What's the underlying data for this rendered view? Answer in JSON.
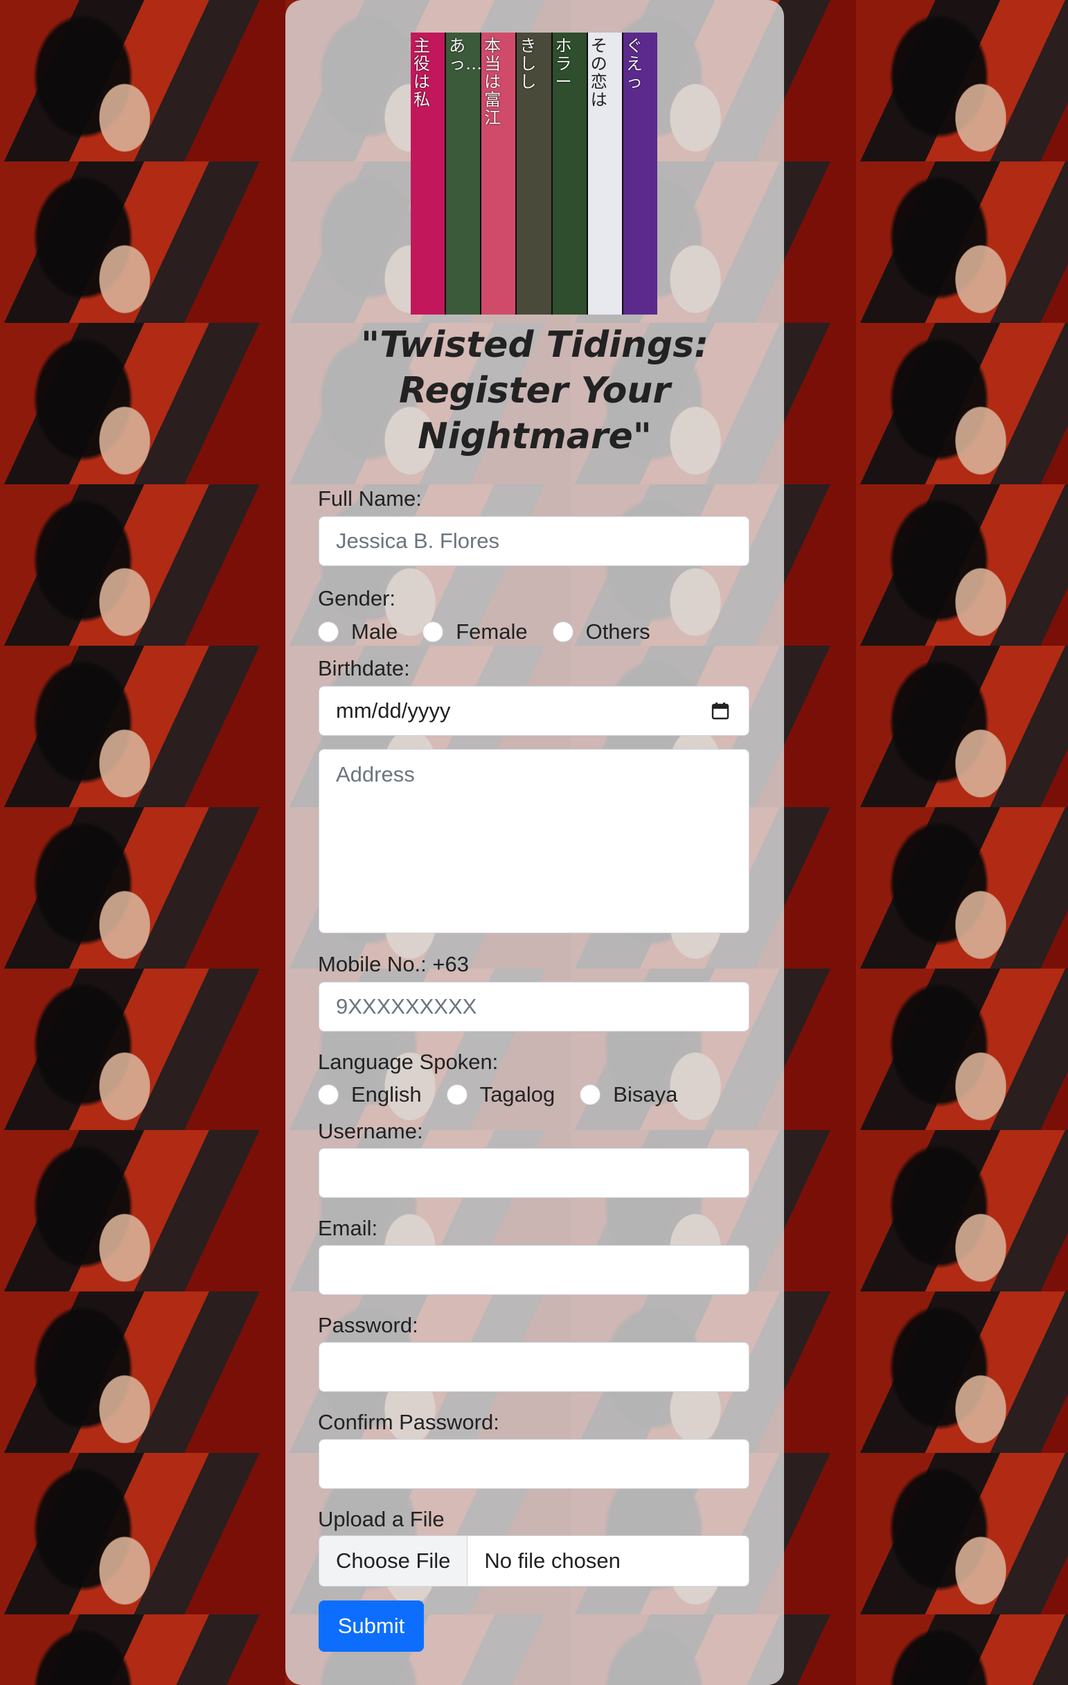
{
  "form": {
    "title": "\"Twisted Tidings: Register Your Nightmare\"",
    "full_name": {
      "label": "Full Name:",
      "placeholder": "Jessica B. Flores"
    },
    "gender": {
      "label": "Gender:",
      "options": [
        "Male",
        "Female",
        "Others"
      ]
    },
    "birthdate": {
      "label": "Birthdate:",
      "placeholder": "mm/dd/yyyy"
    },
    "address": {
      "placeholder": "Address"
    },
    "mobile": {
      "label": "Mobile No.: +63",
      "placeholder": "9XXXXXXXXX"
    },
    "language": {
      "label": "Language Spoken:",
      "options": [
        "English",
        "Tagalog",
        "Bisaya"
      ]
    },
    "username": {
      "label": "Username:",
      "value": ""
    },
    "email": {
      "label": "Email:",
      "value": ""
    },
    "password": {
      "label": "Password:",
      "value": ""
    },
    "confirm_password": {
      "label": "Confirm Password:",
      "value": ""
    },
    "upload": {
      "label": "Upload a File",
      "button": "Choose File",
      "status": "No file chosen"
    },
    "submit_label": "Submit"
  },
  "poster": {
    "strips": [
      {
        "text": "主役は私",
        "color": "#c2185b"
      },
      {
        "text": "あっ…",
        "color": "#3b5a3a"
      },
      {
        "text": "本当は富江",
        "color": "#d04a6a"
      },
      {
        "text": "きしし",
        "color": "#4a4a3a"
      },
      {
        "text": "ホラー",
        "color": "#2e4e2e"
      },
      {
        "text": "その恋は",
        "color": "#e8e8ef"
      },
      {
        "text": "ぐえっ",
        "color": "#5b2a8c"
      }
    ]
  },
  "colors": {
    "submit": "#0d6efd",
    "card": "#dedede"
  }
}
